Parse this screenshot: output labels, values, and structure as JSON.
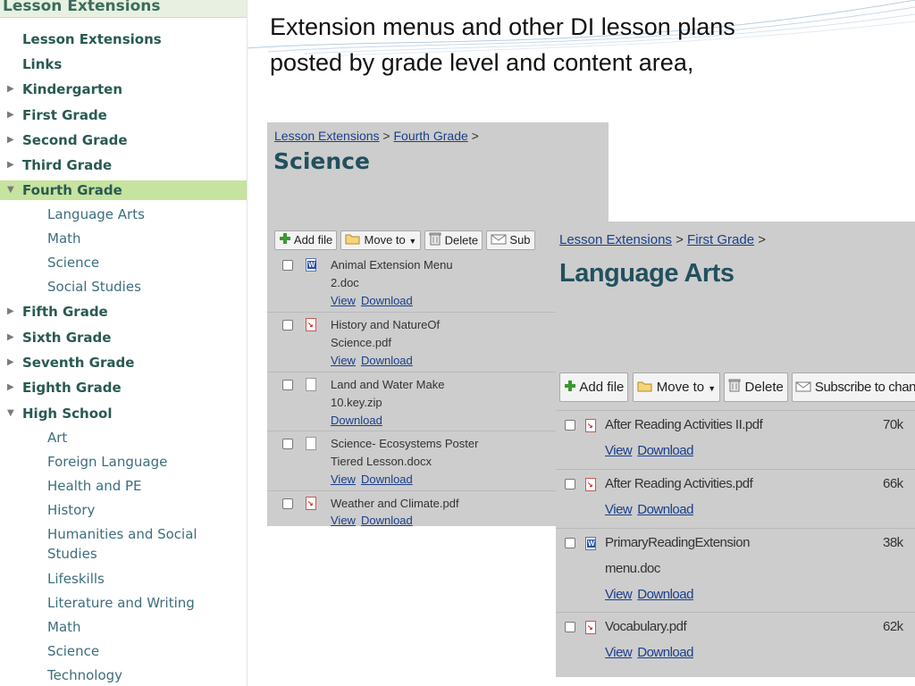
{
  "sidebar": {
    "title": "Lesson Extensions",
    "items": [
      {
        "label": "Lesson Extensions",
        "level": "top",
        "arrow": ""
      },
      {
        "label": "Links",
        "level": "top",
        "arrow": ""
      },
      {
        "label": "Kindergarten",
        "level": "top",
        "arrow": "▶"
      },
      {
        "label": "First Grade",
        "level": "top",
        "arrow": "▶"
      },
      {
        "label": "Second Grade",
        "level": "top",
        "arrow": "▶"
      },
      {
        "label": "Third Grade",
        "level": "top",
        "arrow": "▶"
      },
      {
        "label": "Fourth Grade",
        "level": "top",
        "arrow": "▼",
        "active": true
      },
      {
        "label": "Language Arts",
        "level": "sub"
      },
      {
        "label": "Math",
        "level": "sub"
      },
      {
        "label": "Science",
        "level": "sub"
      },
      {
        "label": "Social Studies",
        "level": "sub"
      },
      {
        "label": "Fifth Grade",
        "level": "top",
        "arrow": "▶"
      },
      {
        "label": "Sixth Grade",
        "level": "top",
        "arrow": "▶"
      },
      {
        "label": "Seventh Grade",
        "level": "top",
        "arrow": "▶"
      },
      {
        "label": "Eighth Grade",
        "level": "top",
        "arrow": "▶"
      },
      {
        "label": "High School",
        "level": "top",
        "arrow": "▼"
      },
      {
        "label": "Art",
        "level": "sub"
      },
      {
        "label": "Foreign Language",
        "level": "sub"
      },
      {
        "label": "Health and PE",
        "level": "sub"
      },
      {
        "label": "History",
        "level": "sub"
      },
      {
        "label": "Humanities and Social",
        "level": "sub"
      },
      {
        "label": "Studies",
        "level": "sub"
      },
      {
        "label": "Lifeskills",
        "level": "sub"
      },
      {
        "label": "Literature and Writing",
        "level": "sub"
      },
      {
        "label": "Math",
        "level": "sub"
      },
      {
        "label": "Science",
        "level": "sub"
      },
      {
        "label": "Technology",
        "level": "sub"
      }
    ]
  },
  "heading": {
    "line1": "Extension menus and other DI lesson plans",
    "line2": "posted by grade level and content area,"
  },
  "science_panel": {
    "crumb_root": "Lesson Extensions",
    "crumb_sep1": " > ",
    "crumb_grade": "Fourth Grade",
    "crumb_sep2": " >",
    "title": "Science",
    "toolbar": {
      "add": "Add file",
      "move": "Move to",
      "delete": "Delete",
      "subscribe": "Sub"
    },
    "files": [
      {
        "line1": "Animal Extension Menu",
        "line2": "2.doc",
        "type": "doc",
        "view": "View",
        "download": "Download"
      },
      {
        "line1": "History and NatureOf",
        "line2": "Science.pdf",
        "type": "pdf",
        "view": "View",
        "download": "Download"
      },
      {
        "line1": "Land and Water Make",
        "line2": "10.key.zip",
        "type": "blank",
        "view": "",
        "download": "Download"
      },
      {
        "line1": "Science- Ecosystems Poster",
        "line2": "Tiered Lesson.docx",
        "type": "blank",
        "view": "View",
        "download": "Download"
      },
      {
        "line1": "Weather and Climate.pdf",
        "line2": "",
        "type": "pdf",
        "view": "View",
        "download": "Download"
      }
    ]
  },
  "la_panel": {
    "crumb_root": "Lesson Extensions",
    "crumb_sep1": " > ",
    "crumb_grade": "First Grade",
    "crumb_sep2": " >",
    "title": "Language Arts",
    "toolbar": {
      "add": "Add file",
      "move": "Move to",
      "delete": "Delete",
      "subscribe": "Subscribe to changes"
    },
    "files": [
      {
        "line1": "After Reading Activities II.pdf",
        "line2": "",
        "type": "pdf",
        "size": "70k",
        "view": "View",
        "download": "Download"
      },
      {
        "line1": "After Reading Activities.pdf",
        "line2": "",
        "type": "pdf",
        "size": "66k",
        "view": "View",
        "download": "Download"
      },
      {
        "line1": "PrimaryReadingExtension",
        "line2": "menu.doc",
        "type": "doc",
        "size": "38k",
        "view": "View",
        "download": "Download"
      },
      {
        "line1": "Vocabulary.pdf",
        "line2": "",
        "type": "pdf",
        "size": "62k",
        "view": "View",
        "download": "Download"
      }
    ]
  },
  "colors": {
    "sidebar_active": "#c6e39f",
    "title_teal": "#23505e",
    "link_blue": "#1a3f8c",
    "panel_gray": "#cdcdcd"
  }
}
